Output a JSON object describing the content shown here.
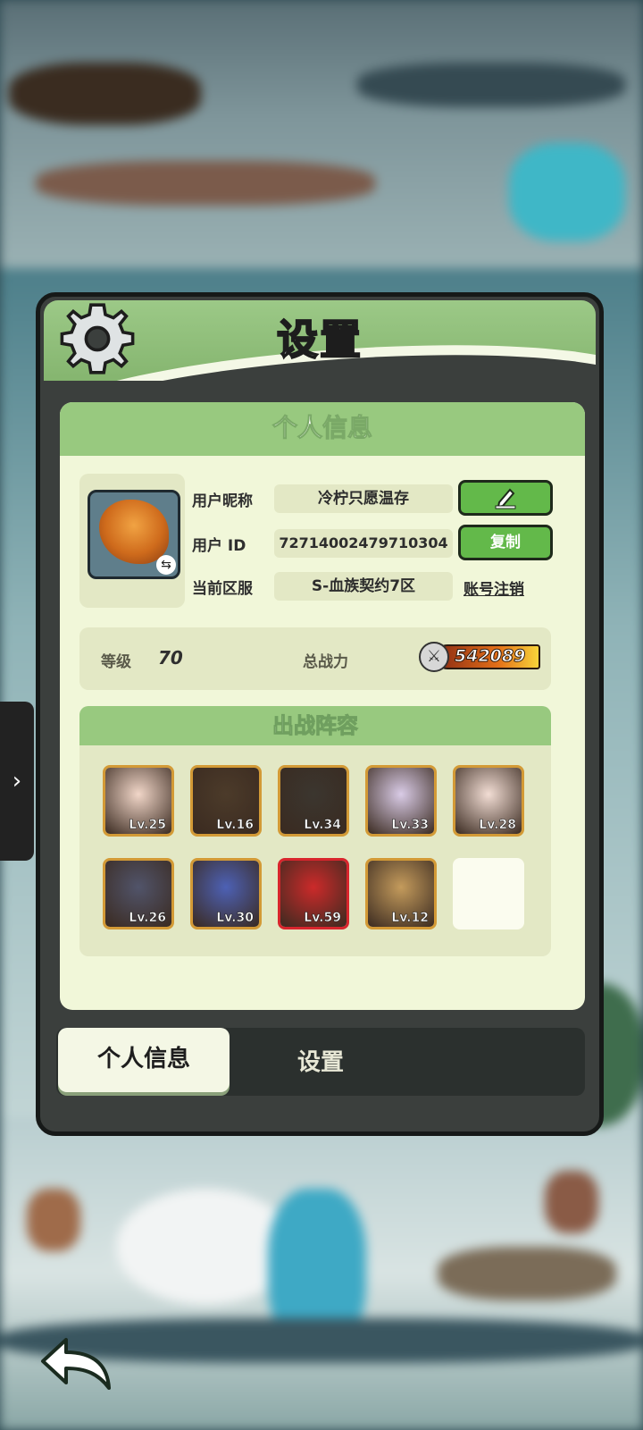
{
  "dialog": {
    "title": "设置",
    "panel_title": "个人信息",
    "profile": {
      "nickname_label": "用户昵称",
      "nickname": "冷柠只愿温存",
      "id_label": "用户  ID",
      "user_id": "72714002479710304",
      "server_label": "当前区服",
      "server": "S-血族契约7区",
      "copy_label": "复制",
      "cancel_account_label": "账号注销"
    },
    "stats": {
      "level_label": "等级",
      "level": "70",
      "power_label": "总战力",
      "power": "542089"
    },
    "team": {
      "title": "出战阵容",
      "heroes": [
        {
          "level": "Lv.25",
          "color": "#f1d6c8"
        },
        {
          "level": "Lv.16",
          "color": "#4c3b2a"
        },
        {
          "level": "Lv.34",
          "color": "#3b362f"
        },
        {
          "level": "Lv.33",
          "color": "#d9cbe6"
        },
        {
          "level": "Lv.28",
          "color": "#f2ddd4"
        },
        {
          "level": "Lv.26",
          "color": "#51546a"
        },
        {
          "level": "Lv.30",
          "color": "#4d61b5"
        },
        {
          "level": "Lv.59",
          "color": "#cc2a2a"
        },
        {
          "level": "Lv.12",
          "color": "#c49b5c"
        }
      ]
    },
    "tabs": {
      "active": "个人信息",
      "settings": "设置"
    }
  },
  "side_tab": {
    "icon": "chevron-right-icon",
    "glyph": "›"
  }
}
